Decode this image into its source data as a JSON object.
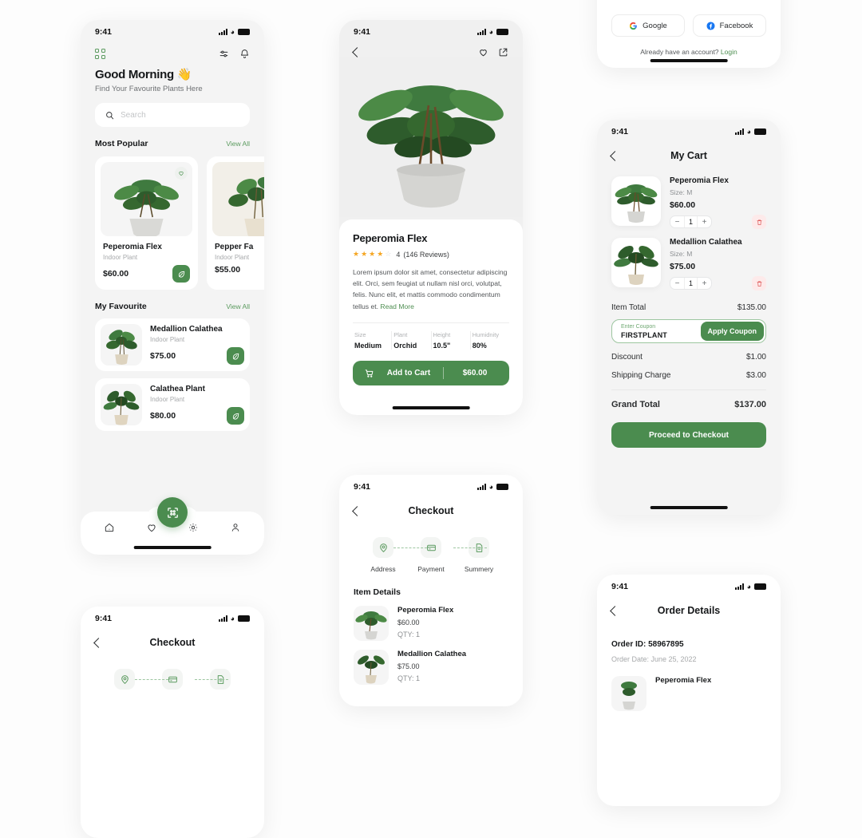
{
  "status_bar": {
    "time": "9:41"
  },
  "home": {
    "greeting": "Good Morning 👋",
    "subtitle": "Find Your Favourite Plants Here",
    "search_placeholder": "Search",
    "sections": [
      {
        "title": "Most Popular",
        "action": "View All"
      },
      {
        "title": "My Favourite",
        "action": "View All"
      }
    ],
    "popular": [
      {
        "name": "Peperomia Flex",
        "type": "Indoor Plant",
        "price": "$60.00"
      },
      {
        "name": "Pepper Fa",
        "type": "Indoor Plant",
        "price": "$55.00"
      }
    ],
    "favourites": [
      {
        "name": "Medallion Calathea",
        "type": "Indoor Plant",
        "price": "$75.00"
      },
      {
        "name": "Calathea Plant",
        "type": "Indoor Plant",
        "price": "$80.00"
      }
    ],
    "tabs": [
      "home-icon",
      "heart-icon",
      "qr-scan-icon",
      "gear-icon",
      "profile-icon"
    ]
  },
  "detail": {
    "title": "Peperomia Flex",
    "rating_value": "4",
    "rating_count": "(146 Reviews)",
    "stars_filled": 4,
    "stars_total": 5,
    "description": "Lorem ipsum dolor sit amet, consectetur adipiscing elit. Orci, sem feugiat ut nullam nisl orci, volutpat, felis. Nunc elit, et mattis commodo condimentum tellus et. ",
    "read_more": "Read More",
    "specs": [
      {
        "label": "Size",
        "value": "Medium"
      },
      {
        "label": "Plant",
        "value": "Orchid"
      },
      {
        "label": "Height",
        "value": "10.5\""
      },
      {
        "label": "Humidnity",
        "value": "80%"
      }
    ],
    "cart_button": "Add to Cart",
    "cart_price": "$60.00"
  },
  "cart": {
    "title": "My Cart",
    "items": [
      {
        "name": "Peperomia Flex",
        "size": "Size: M",
        "price": "$60.00",
        "qty": "1"
      },
      {
        "name": "Medallion Calathea",
        "size": "Size: M",
        "price": "$75.00",
        "qty": "1"
      }
    ],
    "item_total_label": "Item Total",
    "item_total_value": "$135.00",
    "coupon_label": "Enter Coupon",
    "coupon_value": "FIRSTPLANT",
    "apply_label": "Apply Coupon",
    "discount_label": "Discount",
    "discount_value": "$1.00",
    "shipping_label": "Shipping Charge",
    "shipping_value": "$3.00",
    "grand_label": "Grand Total",
    "grand_value": "$137.00",
    "checkout_button": "Proceed to Checkout"
  },
  "checkout": {
    "title": "Checkout",
    "steps": [
      {
        "label": "Address",
        "icon": "location-pin-icon"
      },
      {
        "label": "Payment",
        "icon": "credit-card-icon"
      },
      {
        "label": "Summery",
        "icon": "document-icon"
      }
    ],
    "item_details_title": "Item Details",
    "items": [
      {
        "name": "Peperomia Flex",
        "price": "$60.00",
        "qty": "QTY: 1"
      },
      {
        "name": "Medallion Calathea",
        "price": "$75.00",
        "qty": "QTY: 1"
      }
    ]
  },
  "login": {
    "google_label": "Google",
    "facebook_label": "Facebook",
    "have_account": "Already have an account?",
    "login_link": "Login"
  },
  "order": {
    "title": "Order Details",
    "order_id": "Order ID: 58967895",
    "order_date": "Order Date: June 25, 2022",
    "item_name": "Peperomia Flex"
  },
  "colors": {
    "accent": "#4b8c4f",
    "accent_light": "#5a9a5e",
    "screen_bg": "#f4f4f4",
    "page_bg": "#fdfdfd",
    "danger": "#e86a6a"
  }
}
